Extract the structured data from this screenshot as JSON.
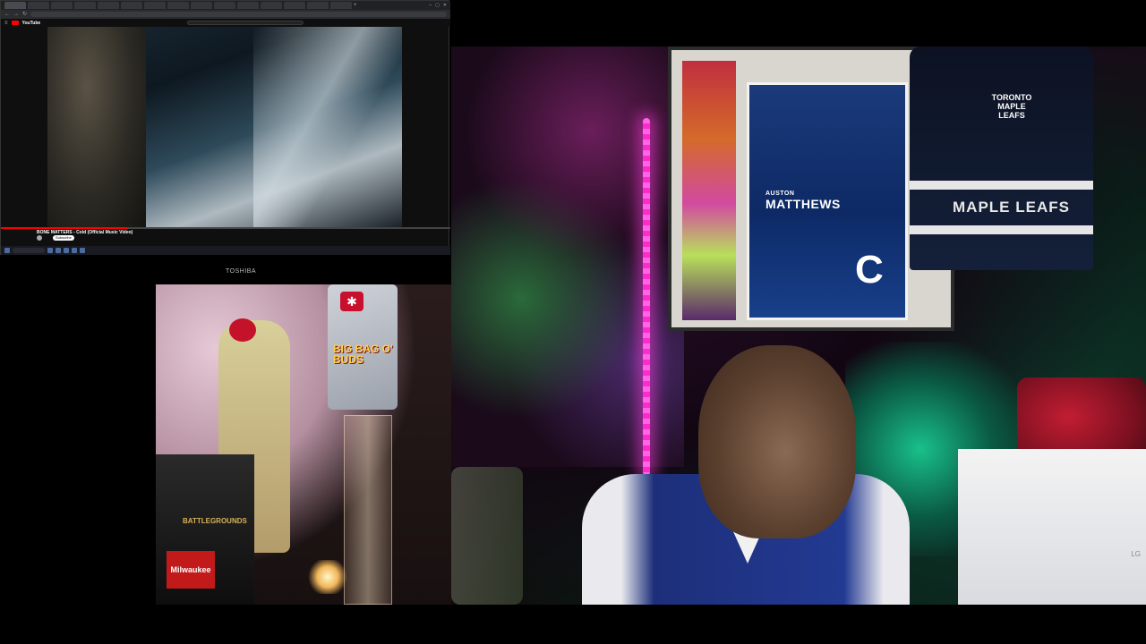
{
  "browser": {
    "tabs": [
      "",
      "",
      "",
      "",
      "",
      "",
      "",
      "",
      "",
      "",
      "",
      "",
      "",
      "",
      ""
    ],
    "active_tab": 0,
    "url": "",
    "site": "YouTube"
  },
  "player": {
    "title": "BONE MATTERS - Cold (Official Music Video)",
    "channel": "",
    "subscribe_label": "Subscribe",
    "progress": 0.28,
    "actions": [
      "",
      "",
      "",
      "",
      "",
      ""
    ],
    "up_next": ""
  },
  "cam2": {
    "label": "TOSHIBA"
  },
  "scene": {
    "poster_name_line1": "AUSTON",
    "poster_name_line2": "MATTHEWS",
    "poster_letter": "C",
    "jersey_logo": "TORONTO MAPLE LEAFS",
    "jersey_word": "MAPLE LEAFS",
    "washer_brand": "LG",
    "bag_text": "BIG BAG O' BUDS",
    "beer_text": "BATTLEGROUNDS",
    "beer_brand": "Milwaukee"
  },
  "colors": {
    "led": "#ff2acb",
    "youtube_red": "#ff0000",
    "jersey_blue": "#233a92"
  }
}
